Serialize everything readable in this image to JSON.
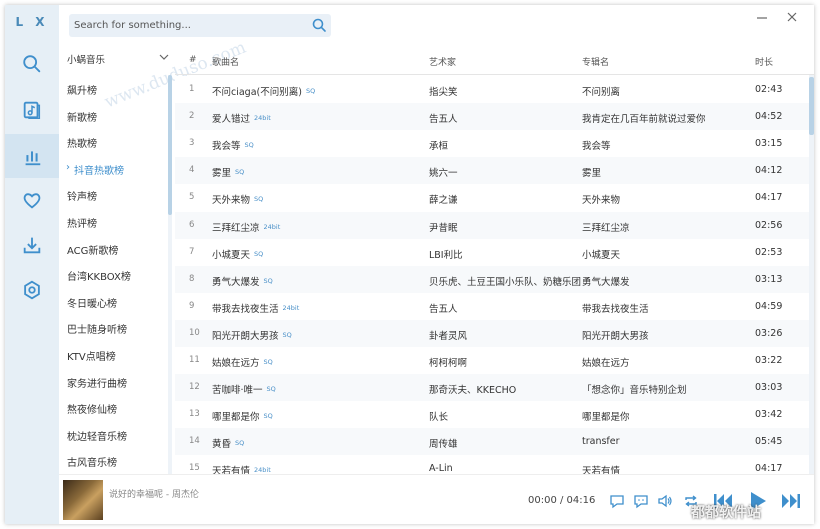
{
  "app": {
    "logo": "L X"
  },
  "search": {
    "placeholder": "Search for something..."
  },
  "rail": [
    "search",
    "song-list",
    "leaderboard",
    "favorites",
    "download",
    "settings"
  ],
  "board": {
    "source": "小蜗音乐",
    "items": [
      "飙升榜",
      "新歌榜",
      "热歌榜",
      "抖音热歌榜",
      "铃声榜",
      "热评榜",
      "ACG新歌榜",
      "台湾KKBOX榜",
      "冬日暖心榜",
      "巴士随身听榜",
      "KTV点唱榜",
      "家务进行曲榜",
      "熬夜修仙榜",
      "枕边轻音乐榜",
      "古风音乐榜"
    ],
    "active_index": 3,
    "active_arrow": "›"
  },
  "table": {
    "headers": {
      "num": "#",
      "title": "歌曲名",
      "artist": "艺术家",
      "album": "专辑名",
      "duration": "时长"
    },
    "rows": [
      {
        "num": "1",
        "title": "不问ciaga(不问别离)",
        "tag": "SQ",
        "artist": "指尖笑",
        "album": "不问别离",
        "duration": "02:43"
      },
      {
        "num": "2",
        "title": "爱人错过",
        "tag": "24bit",
        "artist": "告五人",
        "album": "我肯定在几百年前就说过爱你",
        "duration": "04:52"
      },
      {
        "num": "3",
        "title": "我会等",
        "tag": "SQ",
        "artist": "承桓",
        "album": "我会等",
        "duration": "03:15"
      },
      {
        "num": "4",
        "title": "雾里",
        "tag": "SQ",
        "artist": "姚六一",
        "album": "雾里",
        "duration": "04:12"
      },
      {
        "num": "5",
        "title": "天外来物",
        "tag": "SQ",
        "artist": "薛之谦",
        "album": "天外来物",
        "duration": "04:17"
      },
      {
        "num": "6",
        "title": "三拜红尘凉",
        "tag": "24bit",
        "artist": "尹昔眠",
        "album": "三拜红尘凉",
        "duration": "02:56"
      },
      {
        "num": "7",
        "title": "小城夏天",
        "tag": "SQ",
        "artist": "LBI利比",
        "album": "小城夏天",
        "duration": "02:53"
      },
      {
        "num": "8",
        "title": "勇气大爆发",
        "tag": "SQ",
        "artist": "贝乐虎、土豆王国小乐队、奶糖乐团",
        "album": "勇气大爆发",
        "duration": "03:13"
      },
      {
        "num": "9",
        "title": "带我去找夜生活",
        "tag": "24bit",
        "artist": "告五人",
        "album": "带我去找夜生活",
        "duration": "04:59"
      },
      {
        "num": "10",
        "title": "阳光开朗大男孩",
        "tag": "SQ",
        "artist": "卦者灵风",
        "album": "阳光开朗大男孩",
        "duration": "03:26"
      },
      {
        "num": "11",
        "title": "姑娘在远方",
        "tag": "SQ",
        "artist": "柯柯柯啊",
        "album": "姑娘在远方",
        "duration": "03:22"
      },
      {
        "num": "12",
        "title": "苦咖啡·唯一",
        "tag": "SQ",
        "artist": "那奇沃夫、KKECHO",
        "album": "「想念你」音乐特别企划",
        "duration": "03:03"
      },
      {
        "num": "13",
        "title": "哪里都是你",
        "tag": "SQ",
        "artist": "队长",
        "album": "哪里都是你",
        "duration": "03:42"
      },
      {
        "num": "14",
        "title": "黄昏",
        "tag": "SQ",
        "artist": "周传雄",
        "album": "transfer",
        "duration": "05:45"
      },
      {
        "num": "15",
        "title": "天若有情",
        "tag": "24bit",
        "artist": "A-Lin",
        "album": "天若有情",
        "duration": "04:17"
      }
    ]
  },
  "player": {
    "now_playing": "说好的幸福呢 - 周杰伦",
    "time": "00:00 / 04:16"
  },
  "watermark": "www.duduso.com",
  "brand": "都都软件站",
  "colors": {
    "accent": "#3f8fcc",
    "rail_bg": "#e6eff6",
    "player_icon": "#3f8fcc"
  }
}
